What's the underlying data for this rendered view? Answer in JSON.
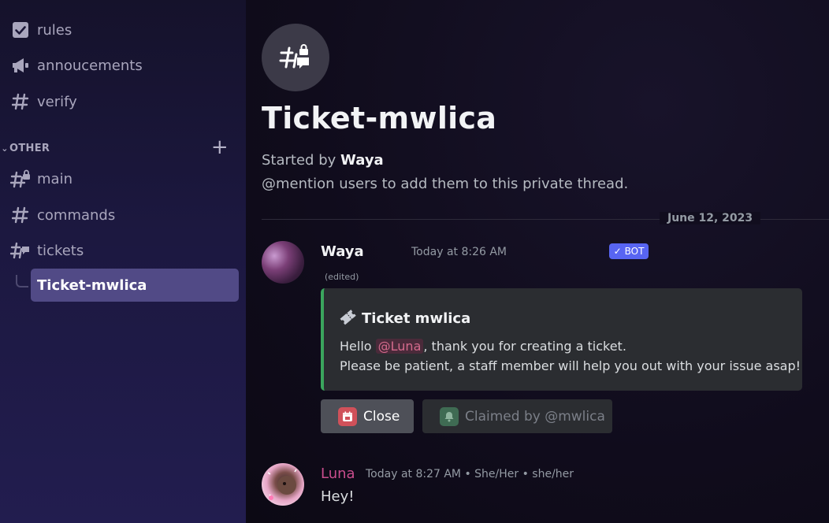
{
  "sidebar": {
    "channels": [
      {
        "label": "rules",
        "icon": "rules-checkbox-icon"
      },
      {
        "label": "annoucements",
        "icon": "megaphone-icon"
      },
      {
        "label": "verify",
        "icon": "hash-icon"
      }
    ],
    "category": {
      "label": "OTHER",
      "chevron": "chevron-down-icon",
      "add_icon": "plus-icon"
    },
    "other_channels": [
      {
        "label": "main",
        "icon": "hash-lock-icon"
      },
      {
        "label": "commands",
        "icon": "hash-icon"
      },
      {
        "label": "tickets",
        "icon": "hash-thread-icon"
      }
    ],
    "active_thread": {
      "label": "Ticket-mwlica"
    }
  },
  "thread_header": {
    "icon": "private-thread-icon",
    "title": "Ticket-mwlica",
    "started_prefix": "Started by",
    "started_by": "Waya",
    "mention_help": "@mention users to add them to this private thread."
  },
  "date_divider": "June 12, 2023",
  "messages": [
    {
      "author": "Waya",
      "author_color": "#f2f3f5",
      "badge": "BOT",
      "badge_check": "✓",
      "timestamp": "Today at 8:26 AM",
      "edited": "(edited)",
      "embed": {
        "accent_color": "#3ba55d",
        "title_icon": "ticket-icon",
        "title": "Ticket mwlica",
        "line1_prefix": "Hello",
        "mention": "@Luna",
        "line1_suffix": ", thank you for creating a ticket.",
        "line2": "Please be patient, a staff member will help you out with your issue asap!"
      },
      "buttons": [
        {
          "label": "Close",
          "icon": "calendar-close-icon",
          "icon_bg": "#d0515a"
        },
        {
          "label": "Claimed by @mwlica",
          "icon": "bell-icon",
          "icon_bg": "#3f6b53"
        }
      ]
    },
    {
      "author": "Luna",
      "author_color": "#c94d8d",
      "timestamp": "Today at 8:27 AM • She/Her • she/her",
      "content": "Hey!"
    }
  ]
}
